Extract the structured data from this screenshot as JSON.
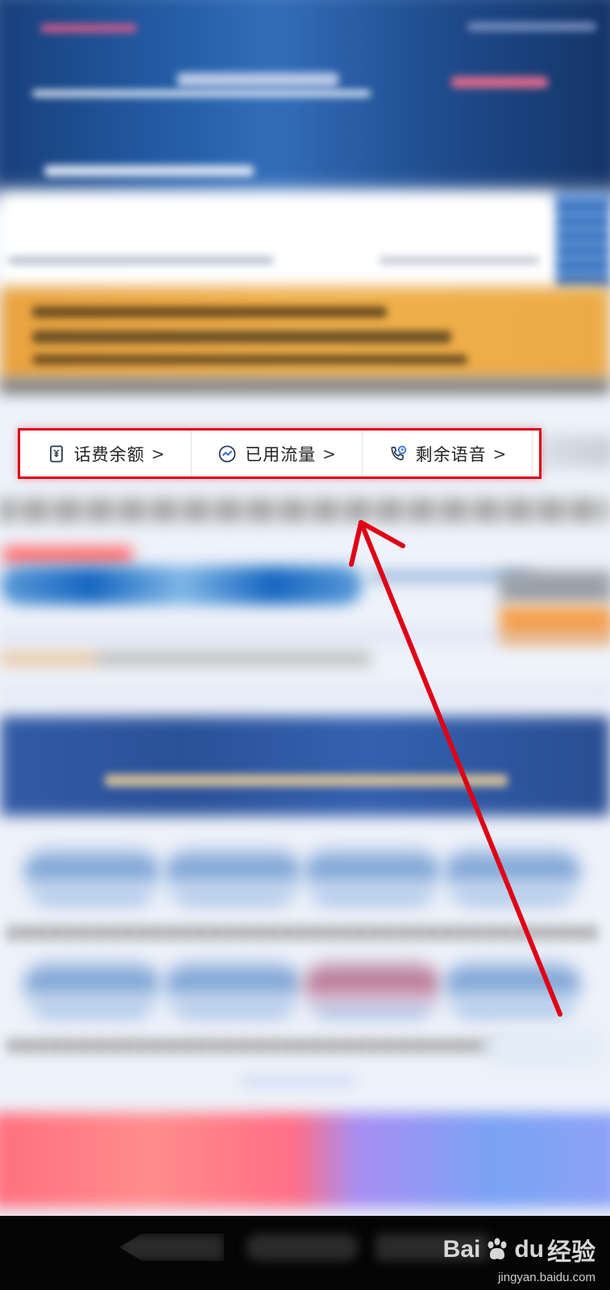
{
  "quick_access": {
    "items": [
      {
        "label": "话费余额",
        "caret": ">",
        "icon": "phone-bill-icon"
      },
      {
        "label": "已用流量",
        "caret": ">",
        "icon": "data-usage-icon"
      },
      {
        "label": "剩余语音",
        "caret": ">",
        "icon": "voice-call-icon"
      }
    ]
  },
  "colors": {
    "highlight_border": "#e00016",
    "annotation_arrow": "#e00016",
    "icon_stroke": "#2b3a55"
  },
  "watermark": {
    "brand": "Bai",
    "brand_suffix": "du",
    "brand_cn": "经验",
    "url": "jingyan.baidu.com"
  }
}
